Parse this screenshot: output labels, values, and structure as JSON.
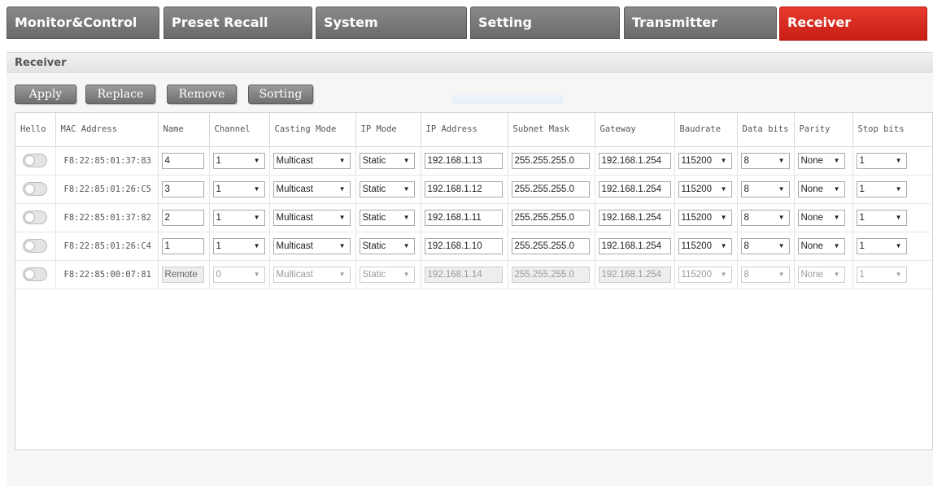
{
  "tabs": [
    {
      "label": "Monitor&Control",
      "active": false
    },
    {
      "label": "Preset Recall",
      "active": false
    },
    {
      "label": "System",
      "active": false
    },
    {
      "label": "Setting",
      "active": false
    },
    {
      "label": "Transmitter",
      "active": false
    },
    {
      "label": "Receiver",
      "active": true
    }
  ],
  "panel": {
    "title": "Receiver"
  },
  "actions": {
    "apply": "Apply",
    "replace": "Replace",
    "remove": "Remove",
    "sorting": "Sorting"
  },
  "table": {
    "headers": {
      "hello": "Hello",
      "mac": "MAC Address",
      "name": "Name",
      "channel": "Channel",
      "casting_mode": "Casting Mode",
      "ip_mode": "IP Mode",
      "ip_address": "IP Address",
      "subnet_mask": "Subnet Mask",
      "gateway": "Gateway",
      "baudrate": "Baudrate",
      "data_bits": "Data bits",
      "parity": "Parity",
      "stop_bits": "Stop bits"
    },
    "rows": [
      {
        "hello": "off",
        "mac": "F8:22:85:01:37:83",
        "name": "4",
        "channel": "1",
        "casting_mode": "Multicast",
        "ip_mode": "Static",
        "ip_address": "192.168.1.13",
        "subnet_mask": "255.255.255.0",
        "gateway": "192.168.1.254",
        "baudrate": "115200",
        "data_bits": "8",
        "parity": "None",
        "stop_bits": "1",
        "disabled": false
      },
      {
        "hello": "off",
        "mac": "F8:22:85:01:26:C5",
        "name": "3",
        "channel": "1",
        "casting_mode": "Multicast",
        "ip_mode": "Static",
        "ip_address": "192.168.1.12",
        "subnet_mask": "255.255.255.0",
        "gateway": "192.168.1.254",
        "baudrate": "115200",
        "data_bits": "8",
        "parity": "None",
        "stop_bits": "1",
        "disabled": false
      },
      {
        "hello": "off",
        "mac": "F8:22:85:01:37:82",
        "name": "2",
        "channel": "1",
        "casting_mode": "Multicast",
        "ip_mode": "Static",
        "ip_address": "192.168.1.11",
        "subnet_mask": "255.255.255.0",
        "gateway": "192.168.1.254",
        "baudrate": "115200",
        "data_bits": "8",
        "parity": "None",
        "stop_bits": "1",
        "disabled": false
      },
      {
        "hello": "off",
        "mac": "F8:22:85:01:26:C4",
        "name": "1",
        "channel": "1",
        "casting_mode": "Multicast",
        "ip_mode": "Static",
        "ip_address": "192.168.1.10",
        "subnet_mask": "255.255.255.0",
        "gateway": "192.168.1.254",
        "baudrate": "115200",
        "data_bits": "8",
        "parity": "None",
        "stop_bits": "1",
        "disabled": false
      },
      {
        "hello": "off",
        "mac": "F8:22:85:00:07:81",
        "name": "Remote",
        "channel": "0",
        "casting_mode": "Multicast",
        "ip_mode": "Static",
        "ip_address": "192.168.1.14",
        "subnet_mask": "255.255.255.0",
        "gateway": "192.168.1.254",
        "baudrate": "115200",
        "data_bits": "8",
        "parity": "None",
        "stop_bits": "1",
        "disabled": true
      }
    ]
  },
  "icons": {
    "dropdown": "dropdown-arrow-icon",
    "toggle": "toggle-switch"
  },
  "colors": {
    "active_tab": "#d42a1f",
    "inactive_tab": "#7a7a7a"
  }
}
